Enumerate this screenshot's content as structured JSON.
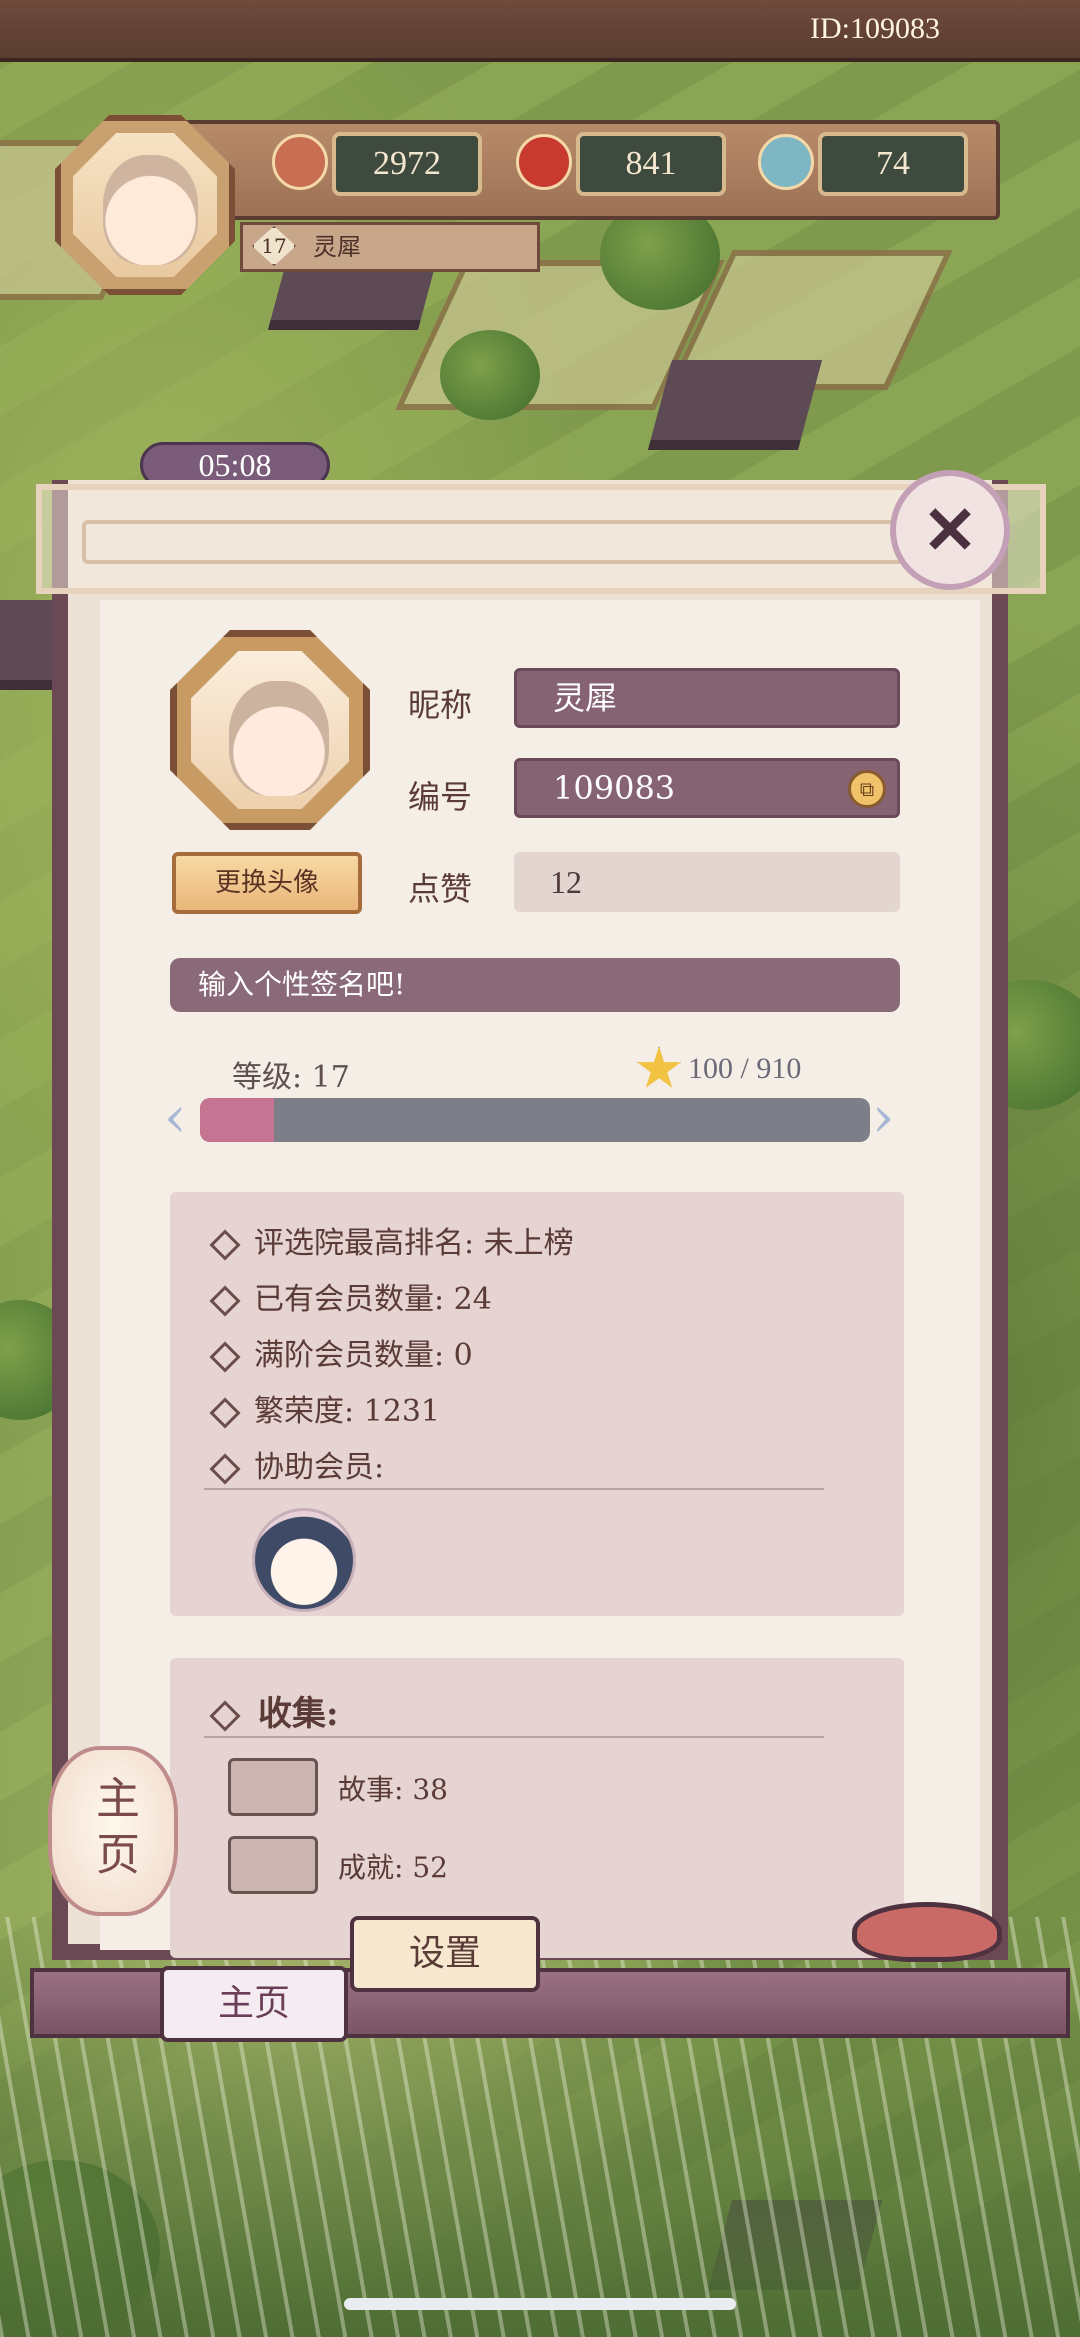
{
  "header": {
    "id_text": "ID:109083",
    "resources": [
      {
        "icon": "shell-coin-icon",
        "value": "2972"
      },
      {
        "icon": "red-orb-icon",
        "value": "841"
      },
      {
        "icon": "swirl-icon",
        "value": "74"
      }
    ],
    "player_level": "17",
    "player_name": "灵犀",
    "timer": "05:08"
  },
  "profile": {
    "change_avatar_label": "更换头像",
    "fields": {
      "nickname_label": "昵称",
      "nickname_value": "灵犀",
      "id_label": "编号",
      "id_value": "109083",
      "likes_label": "点赞",
      "likes_value": "12"
    },
    "signature_placeholder": "输入个性签名吧!",
    "level_label": "等级: 17",
    "exp_text": "100 / 910",
    "exp_progress": 0.11
  },
  "stats": {
    "items": [
      "评选院最高排名: 未上榜",
      "已有会员数量: 24",
      "满阶会员数量: 0",
      "繁荣度: 1231",
      "协助会员:"
    ]
  },
  "collection": {
    "title": "收集:",
    "items": [
      {
        "label": "故事: 38",
        "icon": "books-icon"
      },
      {
        "label": "成就: 52",
        "icon": "open-book-icon"
      }
    ]
  },
  "nav": {
    "lantern_label": "主页",
    "home_label": "主页",
    "settings_label": "设置"
  },
  "colors": {
    "dialog_border": "#6b4954",
    "field_dark": "#856372",
    "exp_fill": "#c57591",
    "exp_track": "#7d7f88"
  }
}
